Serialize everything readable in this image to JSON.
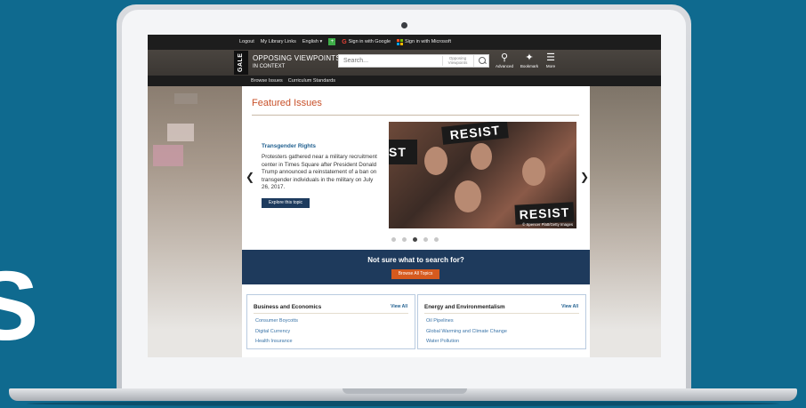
{
  "background": {
    "letter": "S",
    "color": "#0f6a8f"
  },
  "topbar": {
    "links": [
      "Logout",
      "My Library Links",
      "English ▾"
    ],
    "google_signin": "Sign in with Google",
    "microsoft_signin": "Sign in with Microsoft"
  },
  "header": {
    "logo": "GALE",
    "brand_title": "OPPOSING VIEWPOINTS",
    "brand_subtitle": "IN CONTEXT",
    "search": {
      "placeholder": "Search...",
      "scope": "Opposing Viewpoints"
    },
    "tools": [
      {
        "icon": "advanced-search-icon",
        "label": "Advanced"
      },
      {
        "icon": "bookmark-icon",
        "label": "Bookmark"
      },
      {
        "icon": "menu-icon",
        "label": "More"
      }
    ]
  },
  "subnav": {
    "links": [
      "Browse Issues",
      "Curriculum Standards"
    ]
  },
  "featured": {
    "heading": "Featured Issues",
    "slide": {
      "title": "Transgender Rights",
      "description": "Protesters gathered near a military recruitment center in Times Square after President Donald Trump announced a reinstatement of a ban on transgender individuals in the military on July 26, 2017.",
      "button": "Explore this topic",
      "image_signs": [
        "RESIST",
        "ST",
        "RESIST"
      ],
      "image_credit": "© Spencer Platt/Getty Images"
    },
    "carousel": {
      "count": 5,
      "active_index": 2
    }
  },
  "banner": {
    "title": "Not sure what to search for?",
    "button": "Browse All Topics"
  },
  "cards": [
    {
      "title": "Business and Economics",
      "view_all": "View All",
      "items": [
        "Consumer Boycotts",
        "Digital Currency",
        "Health Insurance"
      ]
    },
    {
      "title": "Energy and Environmentalism",
      "view_all": "View All",
      "items": [
        "Oil Pipelines",
        "Global Warming and Climate Change",
        "Water Pollution"
      ]
    }
  ],
  "colors": {
    "accent": "#c8512a",
    "navy": "#1e3a5c",
    "link": "#1f5f8f",
    "button_orange": "#d65a1e"
  }
}
